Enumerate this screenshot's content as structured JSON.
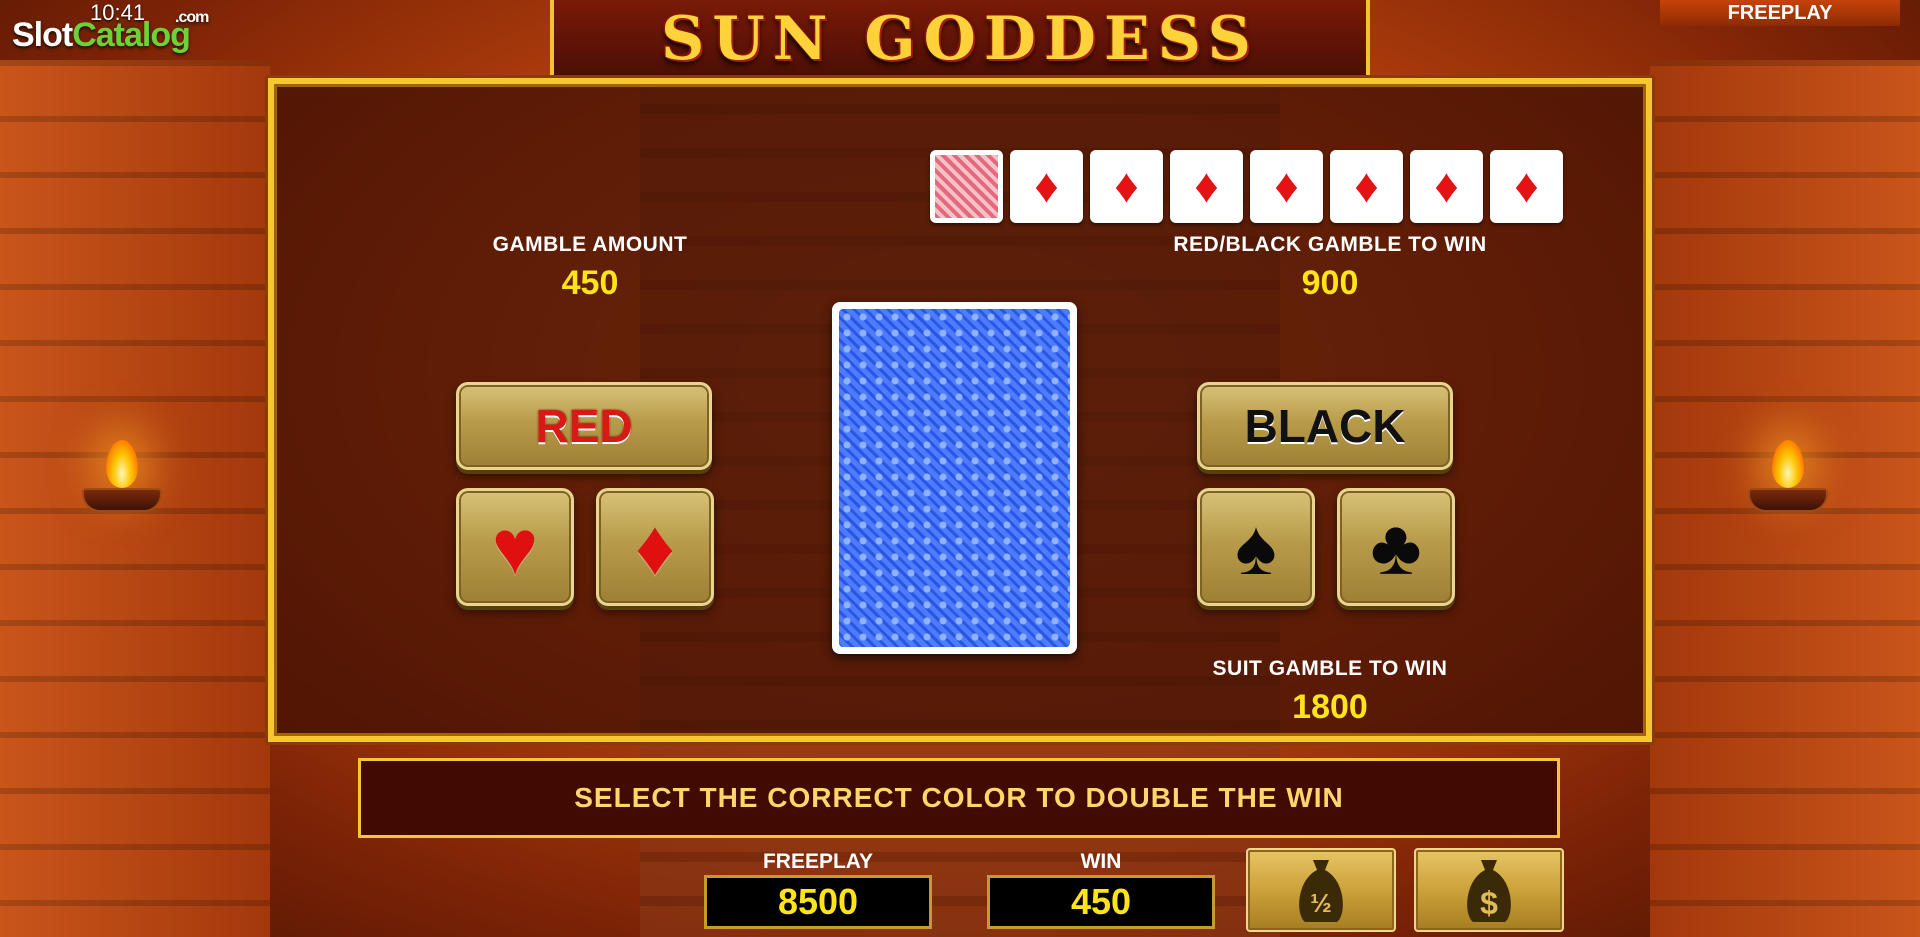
{
  "status": {
    "time": "10:41"
  },
  "watermark": {
    "part1": "Slot",
    "part2": "Catalog",
    "suffix": ".com"
  },
  "top_right": {
    "label": "FREEPLAY"
  },
  "game": {
    "title": "SUN GODDESS"
  },
  "history": {
    "cards": [
      {
        "type": "back"
      },
      {
        "type": "suit",
        "suit": "♦"
      },
      {
        "type": "suit",
        "suit": "♦"
      },
      {
        "type": "suit",
        "suit": "♦"
      },
      {
        "type": "suit",
        "suit": "♦"
      },
      {
        "type": "suit",
        "suit": "♦"
      },
      {
        "type": "suit",
        "suit": "♦"
      },
      {
        "type": "suit",
        "suit": "♦"
      }
    ]
  },
  "gamble": {
    "amount_label": "GAMBLE AMOUNT",
    "amount_value": "450",
    "color_label": "RED/BLACK GAMBLE TO WIN",
    "color_value": "900",
    "suit_label": "SUIT GAMBLE TO WIN",
    "suit_value": "1800"
  },
  "buttons": {
    "red": "RED",
    "black": "BLACK",
    "hearts": "♥",
    "diamonds": "♦",
    "spades": "♠",
    "clubs": "♣"
  },
  "message": "SELECT THE CORRECT COLOR TO DOUBLE THE WIN",
  "bottom": {
    "freeplay_label": "FREEPLAY",
    "freeplay_value": "8500",
    "win_label": "WIN",
    "win_value": "450",
    "half_symbol": "½",
    "dollar_symbol": "$"
  },
  "colors": {
    "gold": "#f6c633",
    "value_yellow": "#ffe41a",
    "red_suit": "#e01010",
    "card_blue": "#3a64f2"
  }
}
